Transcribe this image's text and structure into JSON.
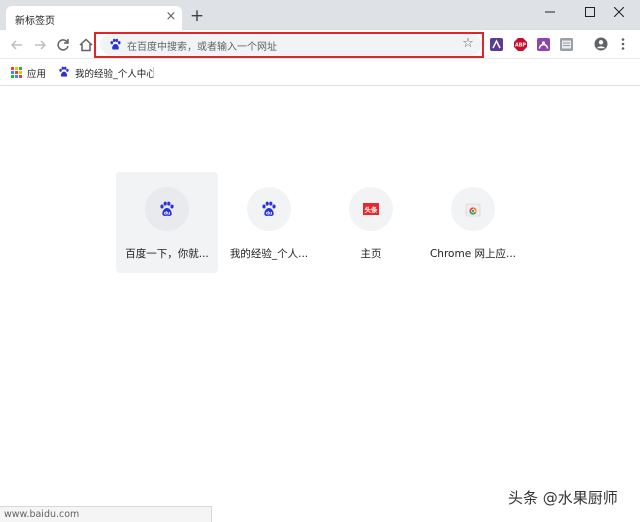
{
  "tab": {
    "title": "新标签页",
    "close_glyph": "×"
  },
  "new_tab_glyph": "+",
  "omnibox": {
    "placeholder": "在百度中搜索，或者输入一个网址",
    "icon": "baidu-paw-icon"
  },
  "bookmark_star_glyph": "☆",
  "bookmarks": [
    {
      "label": "应用",
      "icon": "apps-grid-icon"
    },
    {
      "label": "我的经验_个人中心_",
      "icon": "baidu-paw-icon"
    }
  ],
  "extensions": [
    {
      "name": "extension-purple-icon",
      "text": ""
    },
    {
      "name": "adblock-plus-icon",
      "text": "ABP"
    },
    {
      "name": "extension-arc-icon",
      "text": ""
    },
    {
      "name": "extension-grey-icon",
      "text": ""
    }
  ],
  "tiles": [
    {
      "label": "百度一下，你就...",
      "icon": "baidu-du-icon"
    },
    {
      "label": "我的经验_个人...",
      "icon": "baidu-du-icon"
    },
    {
      "label": "主页",
      "icon": "toutiao-icon",
      "badge": "头条"
    },
    {
      "label": "Chrome 网上应...",
      "icon": "chrome-webstore-icon"
    }
  ],
  "baidu_du_text": "du",
  "status_url": "www.baidu.com",
  "watermark": "头条 @水果厨师",
  "colors": {
    "highlight": "#e0242b",
    "baidu_blue": "#2932e1",
    "abp_red": "#c70d2c",
    "toutiao_red": "#e8282b"
  }
}
